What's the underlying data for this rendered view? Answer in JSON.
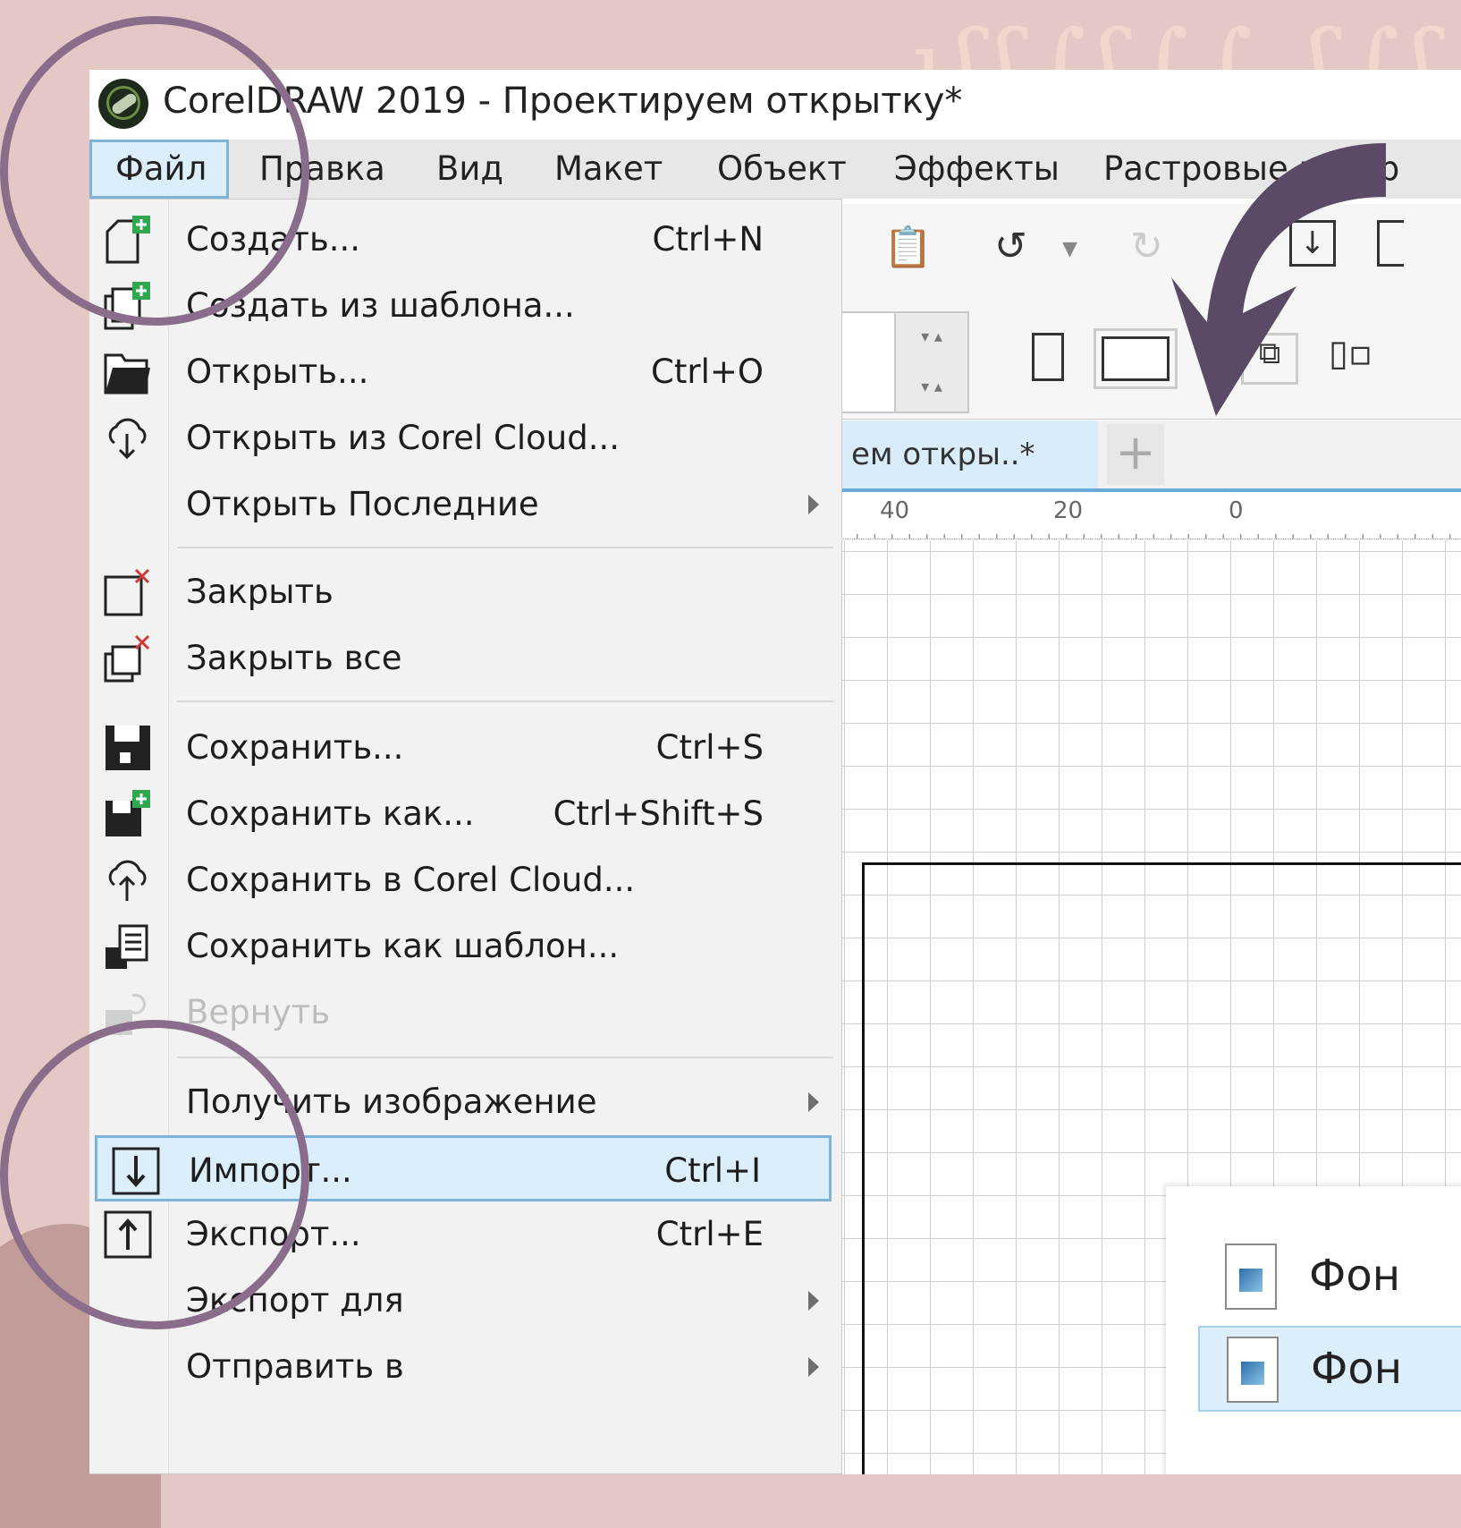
{
  "window": {
    "title": "CorelDRAW 2019 - Проектируем открытку*"
  },
  "menubar": [
    {
      "label": "Файл",
      "active": true
    },
    {
      "label": "Правка"
    },
    {
      "label": "Вид"
    },
    {
      "label": "Макет"
    },
    {
      "label": "Объект"
    },
    {
      "label": "Эффекты"
    },
    {
      "label": "Растровые изобр"
    }
  ],
  "file_menu": [
    {
      "label": "Создать...",
      "shortcut": "Ctrl+N",
      "icon": "new-document-icon"
    },
    {
      "label": "Создать из шаблона...",
      "icon": "new-from-template-icon"
    },
    {
      "label": "Открыть...",
      "shortcut": "Ctrl+O",
      "icon": "folder-icon"
    },
    {
      "label": "Открыть из Corel Cloud...",
      "icon": "cloud-download-icon"
    },
    {
      "label": "Открыть Последние",
      "submenu": true
    },
    {
      "label": "Закрыть",
      "icon": "close-document-icon"
    },
    {
      "label": "Закрыть все",
      "icon": "close-all-icon"
    },
    {
      "label": "Сохранить...",
      "shortcut": "Ctrl+S",
      "icon": "save-icon"
    },
    {
      "label": "Сохранить как...",
      "shortcut": "Ctrl+Shift+S",
      "icon": "save-as-icon"
    },
    {
      "label": "Сохранить в Corel Cloud...",
      "icon": "cloud-upload-icon"
    },
    {
      "label": "Сохранить как шаблон...",
      "icon": "save-template-icon"
    },
    {
      "label": "Вернуть",
      "disabled": true,
      "icon": "revert-icon"
    },
    {
      "label": "Получить изображение",
      "submenu": true
    },
    {
      "label": "Импорт...",
      "shortcut": "Ctrl+I",
      "highlighted": true,
      "icon": "import-icon"
    },
    {
      "label": "Экспорт...",
      "shortcut": "Ctrl+E",
      "icon": "export-icon"
    },
    {
      "label": "Экспорт для",
      "submenu": true
    },
    {
      "label": "Отправить в",
      "submenu": true
    }
  ],
  "document_tab": {
    "label": "ем откры..*",
    "add_label": "+"
  },
  "ruler": {
    "labels": [
      "40",
      "20",
      "0"
    ]
  },
  "flyout": [
    {
      "label": "Фон"
    },
    {
      "label": "Фон",
      "highlighted": true
    }
  ],
  "decor": {
    "script_text": "ıʃʃ∫ʃ∫∫ ʃ∫ʃ"
  },
  "colors": {
    "menu_highlight": "#dbeefa",
    "highlight_border": "#7fb2d9",
    "annotation": "#8a6d8a",
    "arrow": "#5a4a65"
  }
}
